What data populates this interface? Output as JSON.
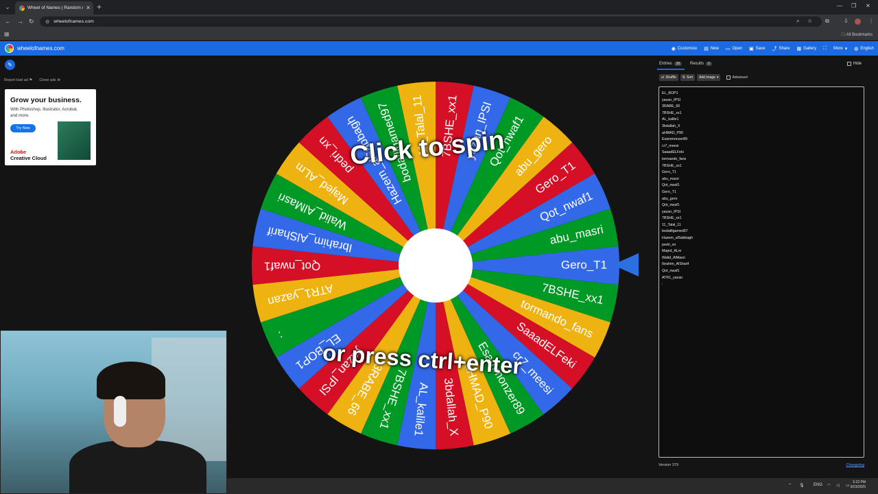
{
  "browser": {
    "tab_title": "Wheel of Names | Random nam...",
    "url": "wheelofnames.com",
    "all_bookmarks": "All Bookmarks"
  },
  "app": {
    "site_title": "wheelofnames.com",
    "menu": [
      {
        "label": "Customize",
        "icon": "palette-icon"
      },
      {
        "label": "New",
        "icon": "file-icon"
      },
      {
        "label": "Open",
        "icon": "folder-icon"
      },
      {
        "label": "Save",
        "icon": "save-icon"
      },
      {
        "label": "Share",
        "icon": "share-icon"
      },
      {
        "label": "Gallery",
        "icon": "gallery-icon"
      },
      {
        "label": "",
        "icon": "fullscreen-icon"
      },
      {
        "label": "More",
        "icon": "more-icon"
      },
      {
        "label": "English",
        "icon": "globe-icon"
      }
    ],
    "primary_color": "#1c6ae2"
  },
  "ad": {
    "report": "Report bad ad",
    "close": "Close ads",
    "headline": "Grow your business.",
    "sub": "With Photoshop, Illustrator, Acrobat, and more.",
    "cta": "Try Now",
    "brand_line1": "Adobe",
    "brand_line2": "Creative Cloud"
  },
  "wheel": {
    "prompt_top": "Click to spin",
    "prompt_bottom": "or press ctrl+enter",
    "colors": [
      "#3369e8",
      "#009925",
      "#eeb211",
      "#d50f25"
    ],
    "segments": [
      "Gero_T1",
      "7BSHE_xx1",
      "tormando_fans",
      "SaaadELFeki",
      "cr7_meesi",
      "Esammonzer89",
      "aHMAD_P90",
      "3bdallah_X",
      "AL_kalile1",
      "7BSHE_xx1",
      "3RABE_66",
      "yazan_IPSI",
      "EL_BOP1",
      ":",
      "ATR1_yazan",
      "Qot_nwaf1",
      "Ibrahim_AlSharif",
      "Walid_AlMasri",
      "Majed_ALm",
      "pedri_xn",
      "Hazem_alSabbagh",
      "bodatllgamed97",
      "11_Talal_11",
      "7BSHE_xx1",
      "yazan_IPSI",
      "Qot_nwaf1",
      "abu_gero",
      "Gero_T1",
      "Qot_nwaf1",
      "abu_masri"
    ]
  },
  "side": {
    "tab_entries": "Entries",
    "entries_count": "30",
    "tab_results": "Results",
    "results_count": "0",
    "hide": "Hide",
    "shuffle": "Shuffle",
    "sort": "Sort",
    "add_image": "Add image",
    "advanced": "Advanced",
    "entries": [
      "EL_BOP1",
      "yazan_IPSI",
      "3RABE_66",
      "7BSHE_xx1",
      "AL_kalile1",
      "3bdallah_X",
      "aHMAD_P90",
      "Esammonzer89",
      "cr7_meesi",
      "SaaadELFeki",
      "tormando_fans",
      "7BSHE_xx1",
      "Gero_T1",
      "abu_masri",
      "Qot_nwaf1",
      "Gero_T1",
      "abu_gero",
      "Qot_nwaf1",
      "yazan_IPSI",
      "7BSHE_xx1",
      "11_Talal_11",
      "bodatllgamed97",
      "Hazem_alSabbagh",
      "pedri_xn",
      "Majed_ALm",
      "Walid_AlMasri",
      "Ibrahim_AlSharif",
      "Qot_nwaf1",
      "ATR1_yazan",
      ":"
    ],
    "version": "Version 379",
    "changelog": "Changelog"
  },
  "taskbar": {
    "lang": "ENG",
    "time": "5:22 PM",
    "date": "9/23/2025"
  }
}
